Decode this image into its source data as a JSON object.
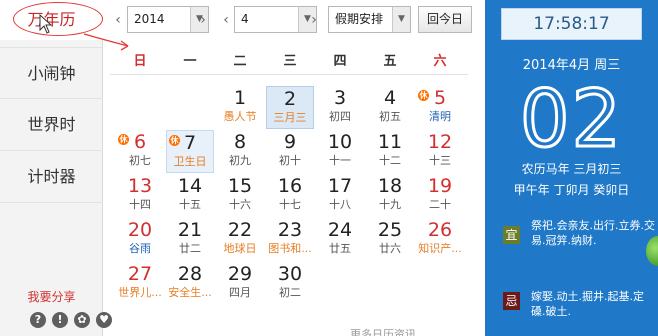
{
  "sidebar": {
    "items": [
      {
        "label": "万年历",
        "active": true
      },
      {
        "label": "小闹钟"
      },
      {
        "label": "世界时"
      },
      {
        "label": "计时器"
      }
    ],
    "share_label": "我要分享",
    "icons": [
      "help-icon",
      "info-icon",
      "settings-icon",
      "skin-icon"
    ]
  },
  "toolbar": {
    "year": "2014",
    "month": "4",
    "holiday_select": "假期安排",
    "today_button": "回今日",
    "prev_glyph": "‹",
    "next_glyph": "›"
  },
  "weekdays": [
    "日",
    "一",
    "二",
    "三",
    "四",
    "五",
    "六"
  ],
  "calendar": {
    "days": [
      {
        "n": "1",
        "sub": "愚人节",
        "col": 2,
        "row": 0,
        "sub_color": "orange"
      },
      {
        "n": "2",
        "sub": "三月三",
        "col": 3,
        "row": 0,
        "sub_color": "orange",
        "today": true
      },
      {
        "n": "3",
        "sub": "初四",
        "col": 4,
        "row": 0
      },
      {
        "n": "4",
        "sub": "初五",
        "col": 5,
        "row": 0
      },
      {
        "n": "5",
        "sub": "清明",
        "col": 6,
        "row": 0,
        "num_color": "red",
        "sub_color": "blue",
        "holiday": true
      },
      {
        "n": "6",
        "sub": "初七",
        "col": 0,
        "row": 1,
        "num_color": "red",
        "holiday": true
      },
      {
        "n": "7",
        "sub": "卫生日",
        "col": 1,
        "row": 1,
        "sub_color": "orange",
        "holiday": true,
        "selected": true
      },
      {
        "n": "8",
        "sub": "初九",
        "col": 2,
        "row": 1
      },
      {
        "n": "9",
        "sub": "初十",
        "col": 3,
        "row": 1
      },
      {
        "n": "10",
        "sub": "十一",
        "col": 4,
        "row": 1
      },
      {
        "n": "11",
        "sub": "十二",
        "col": 5,
        "row": 1
      },
      {
        "n": "12",
        "sub": "十三",
        "col": 6,
        "row": 1,
        "num_color": "red"
      },
      {
        "n": "13",
        "sub": "十四",
        "col": 0,
        "row": 2,
        "num_color": "red"
      },
      {
        "n": "14",
        "sub": "十五",
        "col": 1,
        "row": 2
      },
      {
        "n": "15",
        "sub": "十六",
        "col": 2,
        "row": 2
      },
      {
        "n": "16",
        "sub": "十七",
        "col": 3,
        "row": 2
      },
      {
        "n": "17",
        "sub": "十八",
        "col": 4,
        "row": 2
      },
      {
        "n": "18",
        "sub": "十九",
        "col": 5,
        "row": 2
      },
      {
        "n": "19",
        "sub": "二十",
        "col": 6,
        "row": 2,
        "num_color": "red"
      },
      {
        "n": "20",
        "sub": "谷雨",
        "col": 0,
        "row": 3,
        "num_color": "red",
        "sub_color": "blue"
      },
      {
        "n": "21",
        "sub": "廿二",
        "col": 1,
        "row": 3
      },
      {
        "n": "22",
        "sub": "地球日",
        "col": 2,
        "row": 3,
        "sub_color": "orange"
      },
      {
        "n": "23",
        "sub": "图书和...",
        "col": 3,
        "row": 3,
        "sub_color": "orange"
      },
      {
        "n": "24",
        "sub": "廿五",
        "col": 4,
        "row": 3
      },
      {
        "n": "25",
        "sub": "廿六",
        "col": 5,
        "row": 3
      },
      {
        "n": "26",
        "sub": "知识产...",
        "col": 6,
        "row": 3,
        "num_color": "red",
        "sub_color": "orange"
      },
      {
        "n": "27",
        "sub": "世界儿...",
        "col": 0,
        "row": 4,
        "num_color": "red",
        "sub_color": "orange"
      },
      {
        "n": "28",
        "sub": "安全生...",
        "col": 1,
        "row": 4,
        "sub_color": "orange"
      },
      {
        "n": "29",
        "sub": "四月",
        "col": 2,
        "row": 4
      },
      {
        "n": "30",
        "sub": "初二",
        "col": 3,
        "row": 4
      }
    ],
    "more_text": "更多日历资讯"
  },
  "panel": {
    "clock": "17:58:17",
    "date_line": "2014年4月  周三",
    "big_day": "02",
    "lunar_line": "农历马年 三月初三",
    "ganzhi_line": "甲午年 丁卯月 癸卯日",
    "yi_tag": "宜",
    "yi_text": "祭祀.会亲友.出行.立券.交易.冠笄.纳财.",
    "ji_tag": "忌",
    "ji_text": "嫁娶.动土.掘井.起基.定磉.破土.",
    "holiday_marker": "休"
  },
  "colors": {
    "accent_blue": "#1f78c8",
    "red": "#d32f2f",
    "orange": "#e67e22",
    "holiday_badge": "#ff6f00"
  }
}
